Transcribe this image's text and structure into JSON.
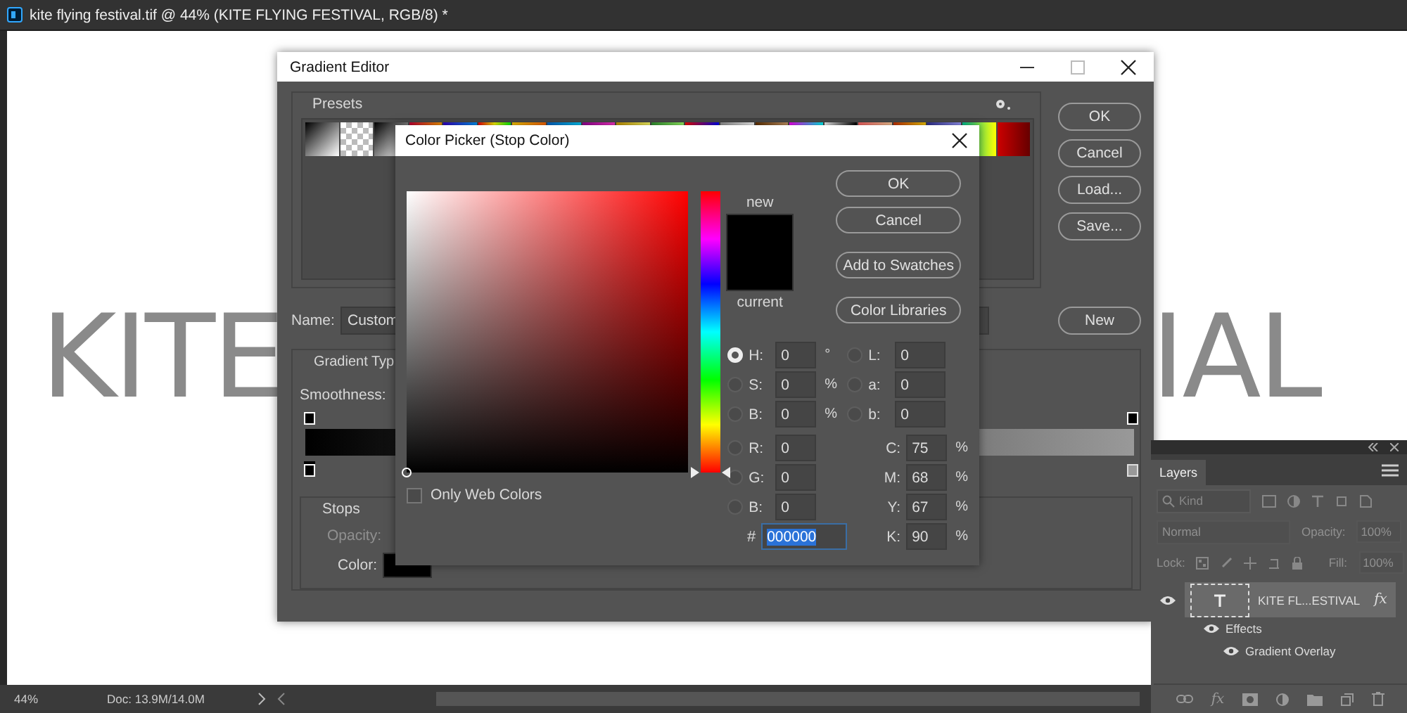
{
  "app_title": "kite flying festival.tif @ 44% (KITE FLYING FESTIVAL, RGB/8) *",
  "canvas": {
    "texts": [
      "KITE",
      "IAL"
    ]
  },
  "status_bar": {
    "zoom": "44%",
    "doc": "Doc: 13.9M/14.0M"
  },
  "gradient_editor": {
    "title": "Gradient Editor",
    "presets_label": "Presets",
    "buttons": [
      "OK",
      "Cancel",
      "Load...",
      "Save..."
    ],
    "new_button": "New",
    "name_label": "Name:",
    "name_value": "Custom",
    "type_label": "Gradient Typ",
    "smoothness_label": "Smoothness:",
    "color_stops": [
      {
        "color": "#000000",
        "selected": true
      },
      {
        "color": "#999999",
        "selected": false
      }
    ],
    "stops_label": "Stops",
    "opacity_label": "Opacity:",
    "opacity_disabled": true,
    "color_label": "Color:"
  },
  "color_picker": {
    "title": "Color Picker (Stop Color)",
    "hue": {
      "level": 0
    },
    "new_label": "new",
    "current_label": "current",
    "buttons": [
      "OK",
      "Cancel",
      "Add to Swatches",
      "Color Libraries"
    ],
    "hsb": [
      {
        "label": "H:",
        "value": "0",
        "unit": "°",
        "selected": true
      },
      {
        "label": "S:",
        "value": "0",
        "unit": "%",
        "selected": false
      },
      {
        "label": "B:",
        "value": "0",
        "unit": "%",
        "selected": false
      }
    ],
    "lab": [
      {
        "label": "L:",
        "value": "0",
        "selected": false
      },
      {
        "label": "a:",
        "value": "0",
        "selected": false
      },
      {
        "label": "b:",
        "value": "0",
        "selected": false
      }
    ],
    "rgb": [
      {
        "label": "R:",
        "value": "0",
        "selected": false
      },
      {
        "label": "G:",
        "value": "0",
        "selected": false
      },
      {
        "label": "B:",
        "value": "0",
        "selected": false
      }
    ],
    "cmyk": [
      {
        "label": "C:",
        "value": "75",
        "unit": "%"
      },
      {
        "label": "M:",
        "value": "68",
        "unit": "%"
      },
      {
        "label": "Y:",
        "value": "67",
        "unit": "%"
      },
      {
        "label": "K:",
        "value": "90",
        "unit": "%"
      }
    ],
    "hex": {
      "label": "#",
      "value": "000000",
      "text_selected": true
    },
    "only_web_colors": {
      "label": "Only Web Colors",
      "checked": false
    }
  },
  "layers_panel": {
    "tab": {
      "label": "Layers",
      "selected": true
    },
    "filter_placeholder": "Kind",
    "blend": {
      "value": "Normal",
      "disabled": true
    },
    "opacity": {
      "label": "Opacity:",
      "value": "100%",
      "disabled": true
    },
    "lock_label": "Lock:",
    "fill": {
      "label": "Fill:",
      "value": "100%",
      "disabled": true
    },
    "layers": [
      {
        "name": "KITE FL...ESTIVAL",
        "kind": "text",
        "badge": "fx",
        "visible": true,
        "selected": true,
        "children": [
          {
            "name": "Effects",
            "visible": true,
            "children": [
              {
                "name": "Gradient Overlay",
                "visible": true
              }
            ]
          }
        ]
      }
    ],
    "footer_fx": "fx"
  }
}
